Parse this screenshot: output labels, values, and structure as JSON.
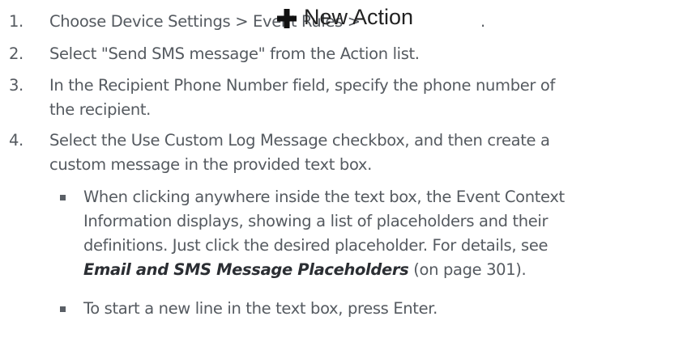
{
  "steps": [
    {
      "number": "1.",
      "lines": [
        "Choose Device Settings > Event Rules >"
      ],
      "button_label": "New Action",
      "trailing": "."
    },
    {
      "number": "2.",
      "lines": [
        "Select \"Send SMS message\" from the Action list."
      ]
    },
    {
      "number": "3.",
      "lines": [
        "In the Recipient Phone Number field, specify the phone number of",
        "the recipient."
      ]
    },
    {
      "number": "4.",
      "lines": [
        "Select the Use Custom Log Message checkbox, and then create a",
        "custom message in the provided text box."
      ]
    }
  ],
  "bullets": [
    {
      "lines": [
        "When clicking anywhere inside the text box, the Event Context",
        "Information displays, showing a list of placeholders and their",
        "definitions. Just click the desired placeholder. For details, see"
      ],
      "link_text": "Email and SMS Message Placeholders",
      "after_link": "(on page 301)."
    },
    {
      "lines": [
        "To start a new line in the text box, press Enter."
      ]
    }
  ],
  "colors": {
    "body_text": "#555a60",
    "button_icon": "#111111",
    "link_text": "#2b2e33"
  },
  "icons": {
    "new_action": "plus-icon"
  }
}
